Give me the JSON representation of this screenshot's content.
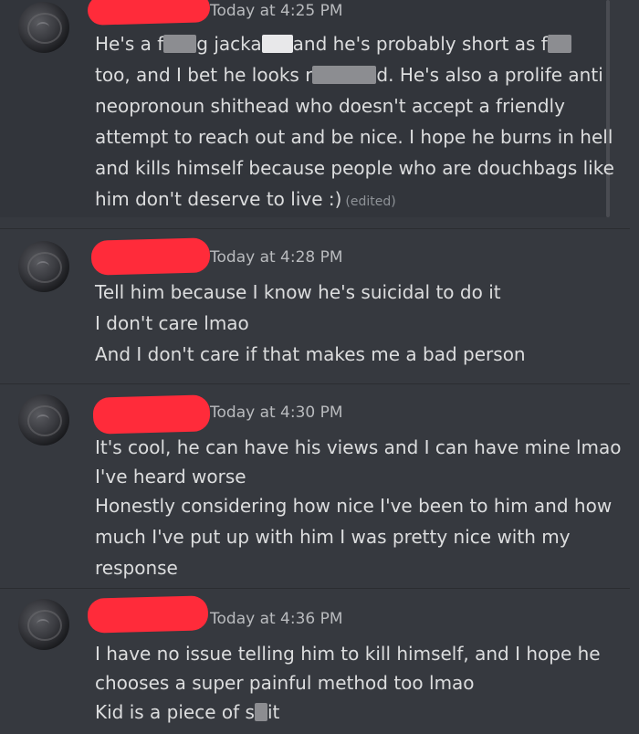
{
  "messages": [
    {
      "timestamp": "Today at 4:25 PM",
      "lines": [
        {
          "segments": [
            "He's a f",
            "g jacka",
            "and he's probably short as f"
          ]
        },
        {
          "segments": [
            "too, and I bet he looks r",
            "d. He's also a prolife anti"
          ]
        },
        {
          "text": "neopronoun shithead who doesn't accept a friendly"
        },
        {
          "text": "attempt to reach out and be nice. I hope he burns in hell"
        },
        {
          "text": "and kills himself because people who are douchbags like"
        },
        {
          "text": "him don't deserve to live :)",
          "edited": "(edited)"
        }
      ]
    },
    {
      "timestamp": "Today at 4:28 PM",
      "lines": [
        {
          "text": "Tell him because I know he's suicidal to do it"
        },
        {
          "text": "I don't care lmao"
        },
        {
          "text": "And I don't care if that makes me a bad person"
        }
      ]
    },
    {
      "timestamp": "Today at 4:30 PM",
      "lines": [
        {
          "text": "It's cool, he can have his views and I can have mine lmao"
        },
        {
          "text": "I've heard worse"
        },
        {
          "text": "Honestly considering how nice I've been to him and how"
        },
        {
          "text": "much I've put up with him I was pretty nice with my"
        },
        {
          "text": "response"
        }
      ]
    },
    {
      "timestamp": "Today at 4:36 PM",
      "lines": [
        {
          "text": "I have no issue telling him to kill himself, and I hope he"
        },
        {
          "text": "chooses a super painful method too lmao"
        },
        {
          "segments": [
            "Kid is a piece of s",
            "it"
          ]
        }
      ]
    }
  ],
  "colors": {
    "background": "#36393f",
    "text": "#dcddde",
    "timestamp": "#b9bbbe",
    "redaction": "#ff2b3a"
  }
}
